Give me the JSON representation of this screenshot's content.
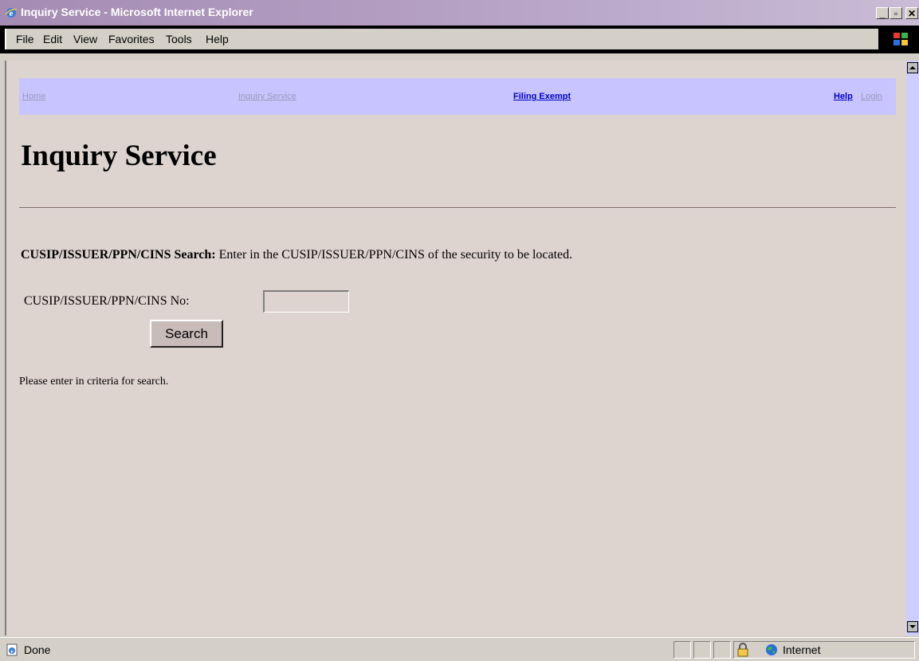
{
  "window": {
    "title": "Inquiry Service - Microsoft Internet Explorer",
    "min_glyph": "_",
    "max_glyph": "▫",
    "close_glyph": "✕"
  },
  "menu": {
    "items": [
      "File",
      "Edit",
      "View",
      "Favorites",
      "Tools",
      "Help"
    ]
  },
  "nav": {
    "home": "Home",
    "inquiry_service": "Inquiry Service",
    "filing_exempt": "Filing Exempt",
    "help": "Help",
    "login": "Login"
  },
  "page": {
    "heading": "Inquiry Service",
    "instruction_bold": "CUSIP/ISSUER/PPN/CINS Search:",
    "instruction_text": " Enter in the CUSIP/ISSUER/PPN/CINS of the security to be located.",
    "field_label": "CUSIP/ISSUER/PPN/CINS No:",
    "field_value": "",
    "search_button": "Search",
    "message": "Please enter in criteria for search."
  },
  "status": {
    "text": "Done",
    "zone": "Internet"
  },
  "colors": {
    "page_background": "#ded4cf",
    "nav_background": "#c7c4ff",
    "link_active": "#0000cc",
    "link_inactive": "#9a9ab8"
  },
  "icons": {
    "app": "ie-logo-icon",
    "throbber": "windows-logo-icon",
    "status": "ie-page-icon",
    "lock": "padlock-icon",
    "zone": "globe-icon"
  }
}
